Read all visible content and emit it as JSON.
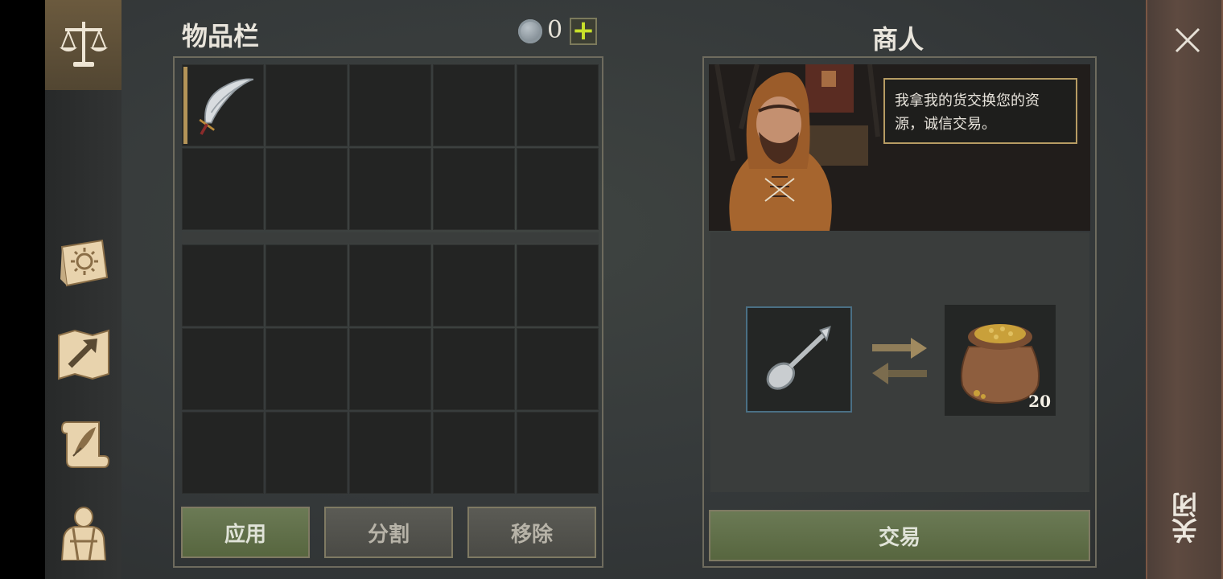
{
  "inventory": {
    "title": "物品栏",
    "coin_count": "0",
    "add_label": "+",
    "top_grid_rows": 2,
    "bottom_grid_rows": 3,
    "columns": 5,
    "items": [
      {
        "slot": 0,
        "icon": "scimitar-icon"
      }
    ],
    "buttons": {
      "apply": "应用",
      "split": "分割",
      "remove": "移除"
    }
  },
  "merchant": {
    "title": "商人",
    "dialog": "我拿我的货交换您的资源，诚信交易。",
    "give_item": {
      "icon": "spoon-icon"
    },
    "get_item": {
      "icon": "grain-sack-icon",
      "quantity": "20"
    },
    "trade_label": "交易"
  },
  "close": {
    "label": "关闭"
  },
  "nav": {
    "items": [
      "balance-scale-icon",
      "sun-book-icon",
      "map-icon",
      "quest-scroll-icon",
      "character-icon"
    ]
  },
  "colors": {
    "accent_green": "#5f6e48",
    "gold": "#b49458",
    "slot_bg": "#232423"
  }
}
